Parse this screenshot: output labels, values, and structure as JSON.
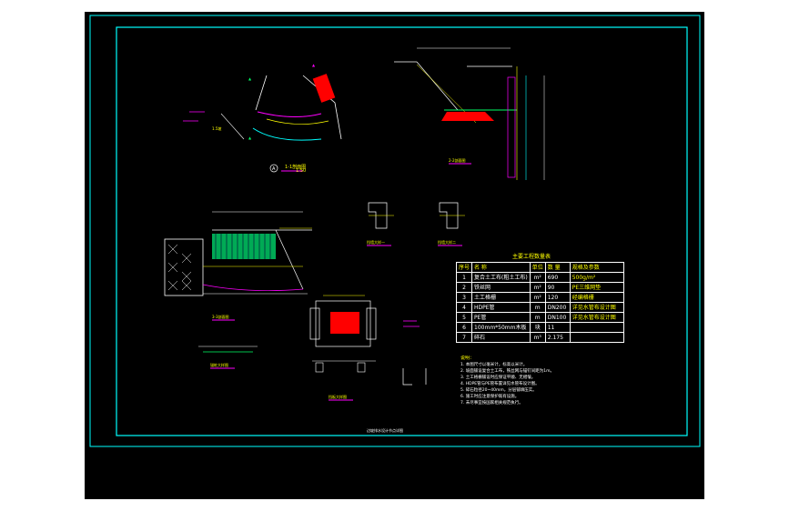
{
  "drawing": {
    "table_title": "主要工程数量表",
    "table_headers": [
      "序号",
      "名  称",
      "单位",
      "数 量",
      "规格及参数"
    ],
    "table_rows": [
      {
        "id": "1",
        "name": "复合土工布(粗土工布)",
        "unit": "m²",
        "qty": "690",
        "spec": "500g/m²"
      },
      {
        "id": "2",
        "name": "铁丝网",
        "unit": "m²",
        "qty": "90",
        "spec": "PE三维网垫"
      },
      {
        "id": "3",
        "name": "土工格栅",
        "unit": "m²",
        "qty": "120",
        "spec": "经编格栅"
      },
      {
        "id": "4",
        "name": "HDPE管",
        "unit": "m",
        "qty": "DN200",
        "spec": "详见水管布设计图"
      },
      {
        "id": "5",
        "name": "PE管",
        "unit": "m",
        "qty": "DN100",
        "spec": "详见水管布设计图"
      },
      {
        "id": "6",
        "name": "100mm*50mm木板",
        "unit": "块",
        "qty": "11",
        "spec": ""
      },
      {
        "id": "7",
        "name": "碎石",
        "unit": "m³",
        "qty": "2.175",
        "spec": ""
      }
    ],
    "notes_title": "说明：",
    "notes": [
      "1. 本图尺寸以毫米计，标高以米计。",
      "2. 坡面铺设复合土工布，铁丝网与锚钉间距为1m。",
      "3. 土工格栅铺设时应保证平顺、无褶皱。",
      "4. HDPE管与PE管布置详见水管布设计图。",
      "5. 碎石粒径20~40mm，分层铺填压实。",
      "6. 施工时应注意保护既有设施。",
      "7. 未尽事宜按国家相关规范执行。"
    ],
    "labels": {
      "section_1": "1-1剖面图",
      "section_2": "2-2剖面图",
      "section_3": "3-3剖面图",
      "detail_1": "挡墙大样一",
      "detail_2": "挡墙大样二",
      "detail_plan": "挡板大样图",
      "detail_anchor": "锚桩大样图",
      "scale": "1:50",
      "bottom_title": "边坡排水设计节点详图"
    },
    "colors": {
      "frame": "#00ffff",
      "text": "#ffff00",
      "accent_red": "#ff0000",
      "green": "#00ff66",
      "magenta": "#ff00ff"
    }
  }
}
